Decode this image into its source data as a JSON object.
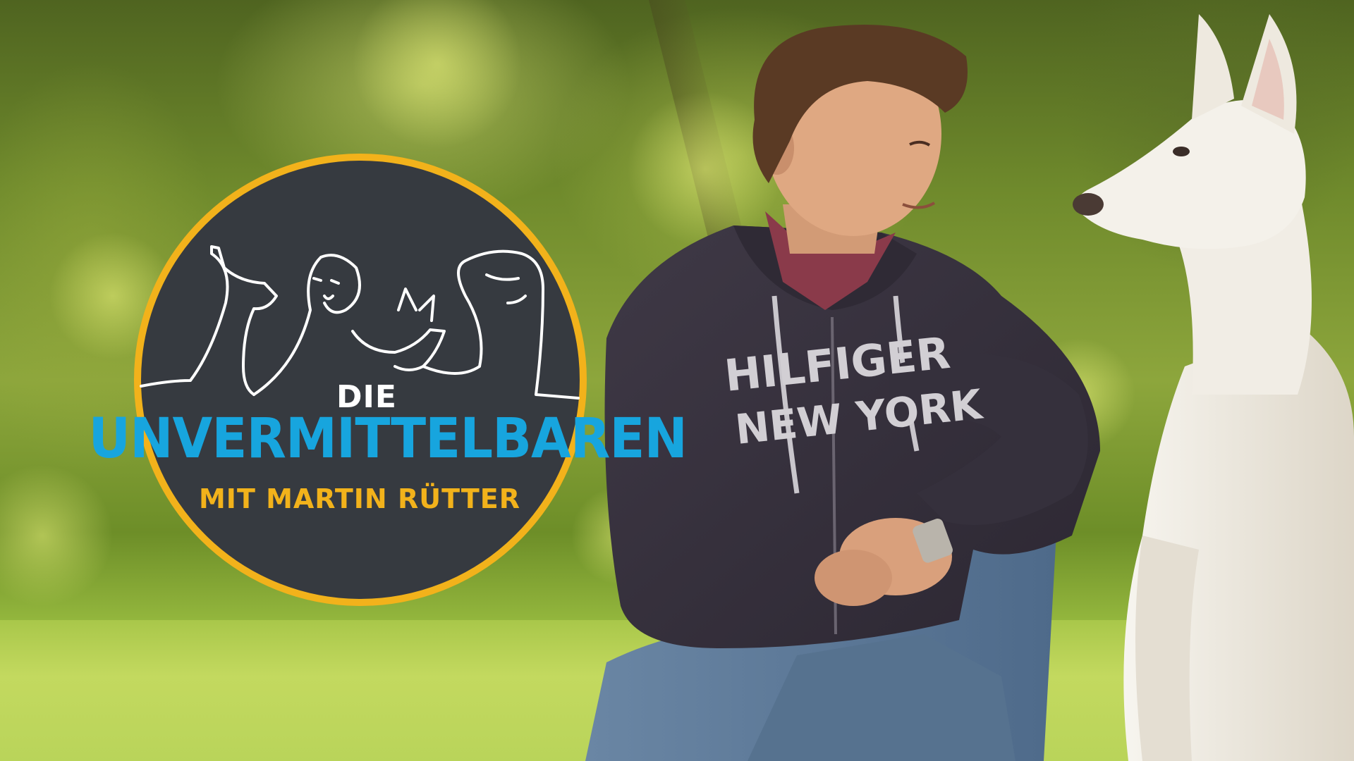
{
  "logo": {
    "line1": "DIE",
    "line2": "UNVERMITTELBAREN",
    "line3": "MIT MARTIN RÜTTER"
  },
  "garment_print": {
    "line1": "HILFIGER",
    "line2": "NEW YORK"
  },
  "colors": {
    "logo_circle": "#363a40",
    "logo_ring": "#f2b21b",
    "title_blue": "#17a5de",
    "subtitle_yellow": "#f2b21b",
    "outline_white": "#ffffff",
    "hoodie": "#3a3440",
    "jeans": "#5f7fa0",
    "dog": "#f2efe8"
  },
  "illustration": {
    "logo_line_art": "line drawing of animals: cat, dog, small fox, horse",
    "person": "man in dark hoodie and jeans sitting on grass",
    "dog": "white shepherd dog sitting"
  }
}
